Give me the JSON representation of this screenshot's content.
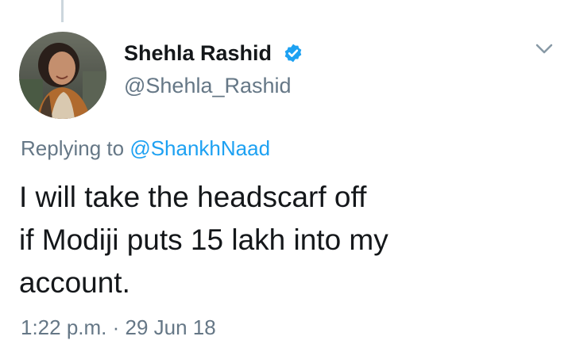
{
  "tweet": {
    "author": {
      "display_name": "Shehla Rashid",
      "handle": "@Shehla_Rashid",
      "verified": true
    },
    "reply_prefix": "Replying to ",
    "reply_mention": "@ShankhNaad",
    "text_lines": [
      "I will take the headscarf off",
      "if Modiji puts 15 lakh into my",
      "account."
    ],
    "time": "1:22 p.m.",
    "separator": " · ",
    "date": "29 Jun 18"
  },
  "icons": {
    "verified": "verified-badge-icon",
    "menu": "chevron-down-icon"
  },
  "colors": {
    "primary_text": "#14171a",
    "secondary_text": "#657786",
    "link": "#1da1f2",
    "verified_badge": "#1da1f2",
    "thread_line": "#ccd6dd"
  }
}
